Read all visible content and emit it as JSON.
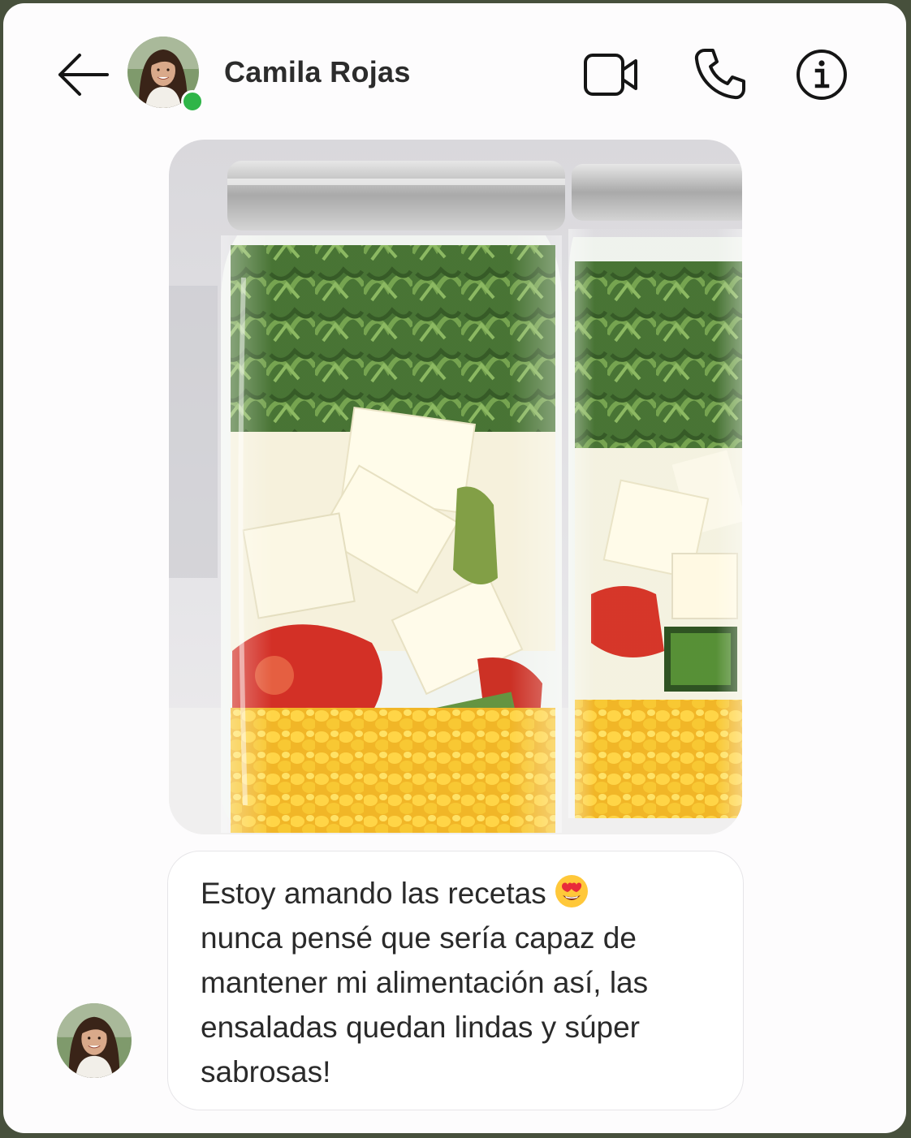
{
  "header": {
    "contact_name": "Camila Rojas",
    "online": true,
    "icons": {
      "back": "arrow-left-icon",
      "video": "video-camera-icon",
      "call": "phone-icon",
      "info": "info-icon"
    }
  },
  "messages": [
    {
      "type": "image",
      "icon": "salad-jars-photo"
    },
    {
      "type": "text",
      "line1": "Estoy amando las recetas ",
      "emoji": "heart-eyes-emoji",
      "rest": "nunca pensé que sería capaz de mantener mi alimentación así, las ensaladas quedan lindas y súper sabrosas!"
    }
  ],
  "colors": {
    "frame": "#47503c",
    "background": "#fdfcfd",
    "online": "#2fb548",
    "text": "#2a2a2a"
  }
}
